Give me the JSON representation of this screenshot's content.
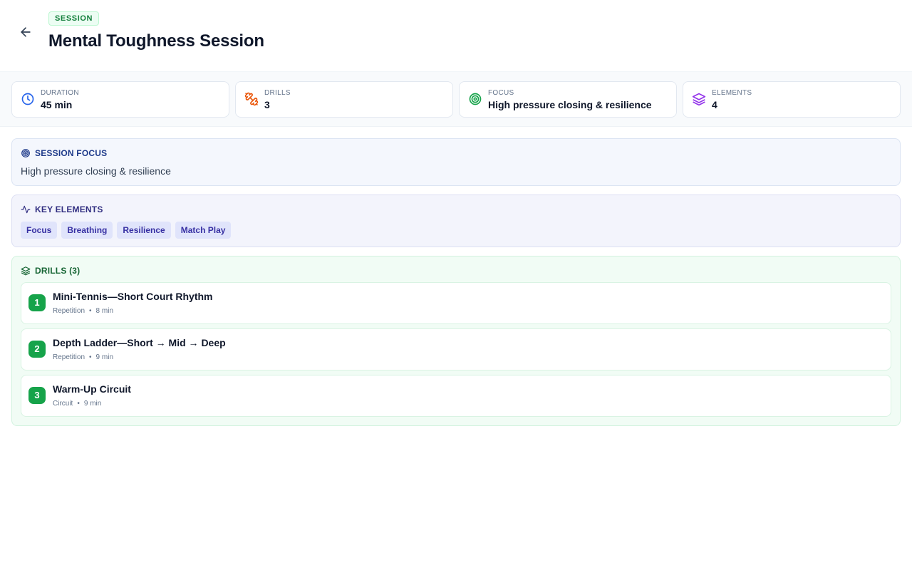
{
  "header": {
    "badge": "SESSION",
    "title": "Mental Toughness Session"
  },
  "stats": [
    {
      "label": "DURATION",
      "value": "45 min",
      "icon": "clock-icon",
      "color": "#2563eb"
    },
    {
      "label": "DRILLS",
      "value": "3",
      "icon": "dumbbell-icon",
      "color": "#ea580c"
    },
    {
      "label": "FOCUS",
      "value": "High pressure closing & resilience",
      "icon": "target-icon",
      "color": "#16a34a"
    },
    {
      "label": "ELEMENTS",
      "value": "4",
      "icon": "layers-icon",
      "color": "#9333ea"
    }
  ],
  "session_focus": {
    "heading": "SESSION FOCUS",
    "text": "High pressure closing & resilience",
    "color": "#1e3a8a"
  },
  "key_elements": {
    "heading": "KEY ELEMENTS",
    "items": [
      "Focus",
      "Breathing",
      "Resilience",
      "Match Play"
    ],
    "color": "#312e81"
  },
  "drills": {
    "heading": "DRILLS (3)",
    "color": "#166534",
    "items": [
      {
        "num": "1",
        "title": "Mini-Tennis—Short Court Rhythm",
        "type": "Repetition",
        "duration": "8 min"
      },
      {
        "num": "2",
        "title": "Depth Ladder—Short → Mid → Deep",
        "type": "Repetition",
        "duration": "9 min"
      },
      {
        "num": "3",
        "title": "Warm-Up Circuit",
        "type": "Circuit",
        "duration": "9 min"
      }
    ]
  }
}
